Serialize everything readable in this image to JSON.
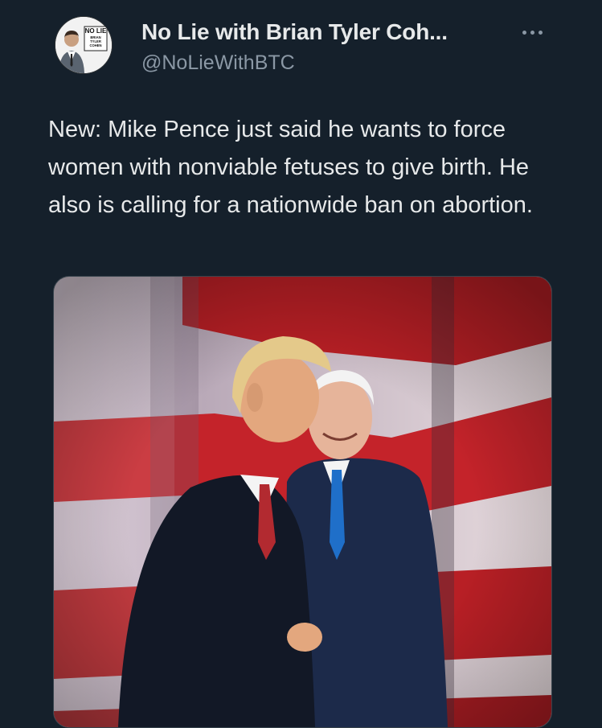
{
  "tweet": {
    "author": {
      "display_name": "No Lie with Brian Tyler Coh...",
      "handle": "@NoLieWithBTC",
      "avatar_logo_text": "NO LIE",
      "avatar_sub_lines": [
        "BRIAN",
        "TYLER",
        "COHEN"
      ]
    },
    "text": "New: Mike Pence just said he wants to force women with nonviable fetuses to give birth. He also is calling for a nationwide ban on abortion.",
    "media": {
      "type": "photo",
      "icon": "photo-image"
    }
  },
  "icons": {
    "more": "more-horizontal-icon"
  },
  "colors": {
    "background": "#15202b",
    "primary_text": "#e7e9ea",
    "secondary_text": "#8b98a5",
    "border": "#38444d"
  }
}
